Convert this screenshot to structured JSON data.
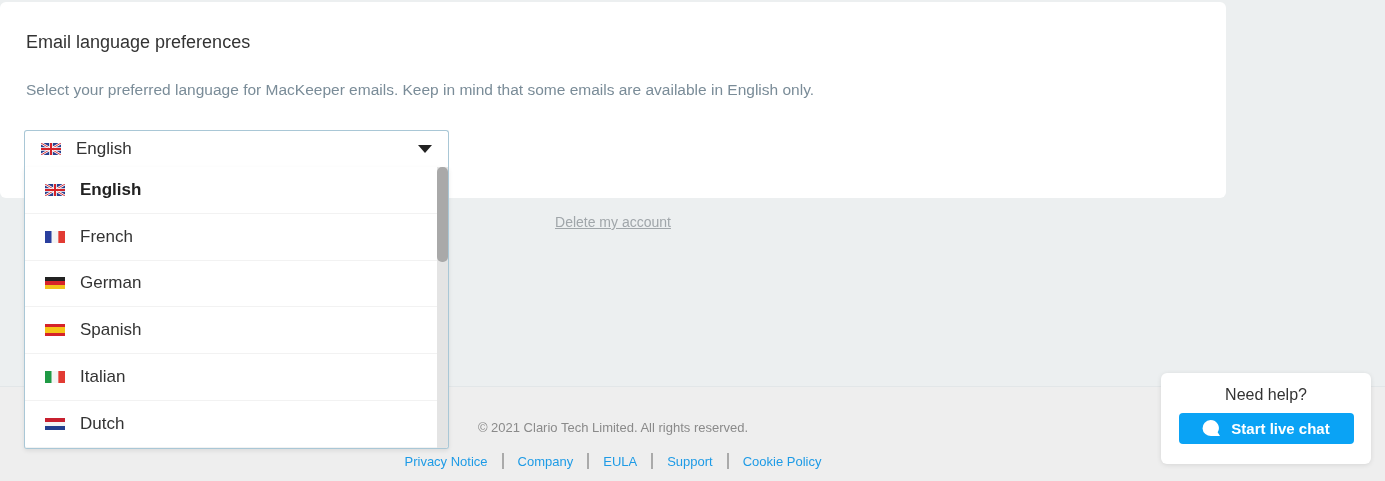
{
  "card": {
    "title": "Email language preferences",
    "description": "Select your preferred language for MacKeeper emails. Keep in mind that some emails are available in English only."
  },
  "language_select": {
    "value": "English",
    "kind": "uk",
    "expanded": true,
    "options": [
      {
        "label": "English",
        "kind": "uk",
        "selected": true
      },
      {
        "label": "French",
        "kind": "fr",
        "selected": false
      },
      {
        "label": "German",
        "kind": "de",
        "selected": false
      },
      {
        "label": "Spanish",
        "kind": "es",
        "selected": false
      },
      {
        "label": "Italian",
        "kind": "it",
        "selected": false
      },
      {
        "label": "Dutch",
        "kind": "nl",
        "selected": false
      }
    ]
  },
  "delete_link": "Delete my account",
  "footer": {
    "copyright": "© 2021 Clario Tech Limited. All rights reserved.",
    "links": [
      "Privacy Notice",
      "Company",
      "EULA",
      "Support",
      "Cookie Policy"
    ]
  },
  "help_widget": {
    "title": "Need help?",
    "button": "Start live chat"
  }
}
